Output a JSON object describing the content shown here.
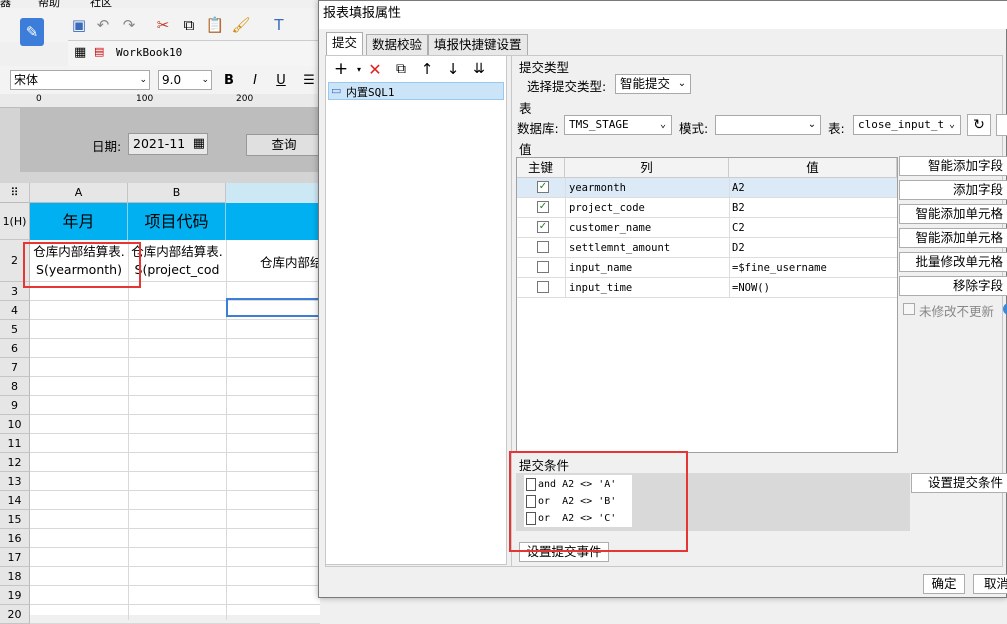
{
  "menu": {
    "items": [
      "器",
      "帮助",
      "社区"
    ]
  },
  "workbook": {
    "tab": "WorkBook10"
  },
  "font": {
    "family": "宋体",
    "size": "9.0",
    "bold": "B",
    "italic": "I",
    "underline": "U"
  },
  "ruler": {
    "marks": [
      "0",
      "100",
      "200"
    ]
  },
  "params": {
    "date_label": "日期:",
    "date_value": "2021-11",
    "query_button": "查询"
  },
  "sheet": {
    "columns": [
      "A",
      "B"
    ],
    "rows": [
      "1(H)",
      "2",
      "3",
      "4",
      "5",
      "6",
      "7",
      "8",
      "9",
      "10",
      "11",
      "12",
      "13",
      "14",
      "15",
      "16",
      "17",
      "18",
      "19",
      "20"
    ],
    "header_cells": [
      "年月",
      "项目代码"
    ],
    "row2_cells": [
      "仓库内部结算表.S(yearmonth)",
      "仓库内部结算表.S(project_code)",
      "仓库内部结"
    ]
  },
  "dialog": {
    "title": "报表填报属性",
    "tabs": [
      "提交",
      "数据校验",
      "填报快捷键设置"
    ],
    "sql_item": "内置SQL1",
    "submit_type_section": "提交类型",
    "submit_type_label": "选择提交类型:",
    "submit_type_value": "智能提交",
    "table_section": "表",
    "db_label": "数据库:",
    "db_value": "TMS_STAGE",
    "mode_label": "模式:",
    "mode_value": "",
    "table_label": "表:",
    "table_value": "close_input_t",
    "value_section": "值",
    "table_headers": [
      "主键",
      "列",
      "值"
    ],
    "rows": [
      {
        "key": true,
        "column": "yearmonth",
        "value": "A2"
      },
      {
        "key": true,
        "column": "project_code",
        "value": "B2"
      },
      {
        "key": true,
        "column": "customer_name",
        "value": "C2"
      },
      {
        "key": false,
        "column": "settlemnt_amount",
        "value": "D2"
      },
      {
        "key": false,
        "column": "input_name",
        "value": "=$fine_username"
      },
      {
        "key": false,
        "column": "input_time",
        "value": "=NOW()"
      }
    ],
    "side_buttons": [
      "智能添加字段",
      "添加字段",
      "智能添加单元格",
      "智能添加单元格",
      "批量修改单元格",
      "移除字段"
    ],
    "unmodified_checkbox": "未修改不更新",
    "condition_section": "提交条件",
    "conditions": [
      "and A2 <> 'A'",
      "or  A2 <> 'B'",
      "or  A2 <> 'C'"
    ],
    "set_condition_button": "设置提交条件",
    "set_event_button": "设置提交事件",
    "ok_button": "确定",
    "cancel_button": "取消"
  },
  "colors": {
    "header_fill": "#00b0f0",
    "highlight": "#e53535",
    "selection": "#cce4f7"
  }
}
